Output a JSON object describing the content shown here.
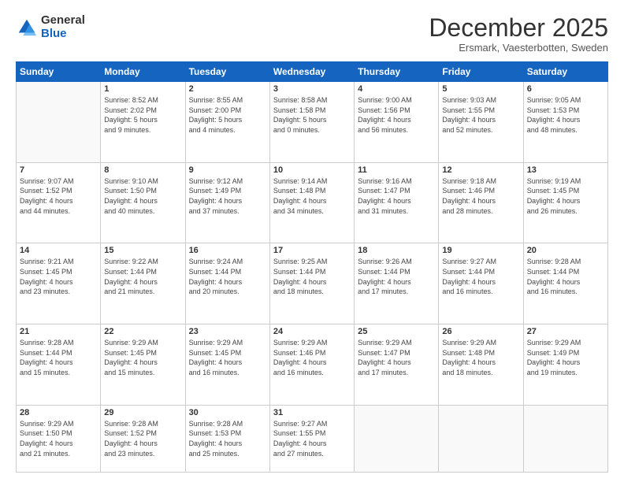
{
  "logo": {
    "general": "General",
    "blue": "Blue"
  },
  "title": "December 2025",
  "location": "Ersmark, Vaesterbotten, Sweden",
  "days_header": [
    "Sunday",
    "Monday",
    "Tuesday",
    "Wednesday",
    "Thursday",
    "Friday",
    "Saturday"
  ],
  "weeks": [
    [
      {
        "day": "",
        "info": ""
      },
      {
        "day": "1",
        "info": "Sunrise: 8:52 AM\nSunset: 2:02 PM\nDaylight: 5 hours\nand 9 minutes."
      },
      {
        "day": "2",
        "info": "Sunrise: 8:55 AM\nSunset: 2:00 PM\nDaylight: 5 hours\nand 4 minutes."
      },
      {
        "day": "3",
        "info": "Sunrise: 8:58 AM\nSunset: 1:58 PM\nDaylight: 5 hours\nand 0 minutes."
      },
      {
        "day": "4",
        "info": "Sunrise: 9:00 AM\nSunset: 1:56 PM\nDaylight: 4 hours\nand 56 minutes."
      },
      {
        "day": "5",
        "info": "Sunrise: 9:03 AM\nSunset: 1:55 PM\nDaylight: 4 hours\nand 52 minutes."
      },
      {
        "day": "6",
        "info": "Sunrise: 9:05 AM\nSunset: 1:53 PM\nDaylight: 4 hours\nand 48 minutes."
      }
    ],
    [
      {
        "day": "7",
        "info": "Sunrise: 9:07 AM\nSunset: 1:52 PM\nDaylight: 4 hours\nand 44 minutes."
      },
      {
        "day": "8",
        "info": "Sunrise: 9:10 AM\nSunset: 1:50 PM\nDaylight: 4 hours\nand 40 minutes."
      },
      {
        "day": "9",
        "info": "Sunrise: 9:12 AM\nSunset: 1:49 PM\nDaylight: 4 hours\nand 37 minutes."
      },
      {
        "day": "10",
        "info": "Sunrise: 9:14 AM\nSunset: 1:48 PM\nDaylight: 4 hours\nand 34 minutes."
      },
      {
        "day": "11",
        "info": "Sunrise: 9:16 AM\nSunset: 1:47 PM\nDaylight: 4 hours\nand 31 minutes."
      },
      {
        "day": "12",
        "info": "Sunrise: 9:18 AM\nSunset: 1:46 PM\nDaylight: 4 hours\nand 28 minutes."
      },
      {
        "day": "13",
        "info": "Sunrise: 9:19 AM\nSunset: 1:45 PM\nDaylight: 4 hours\nand 26 minutes."
      }
    ],
    [
      {
        "day": "14",
        "info": "Sunrise: 9:21 AM\nSunset: 1:45 PM\nDaylight: 4 hours\nand 23 minutes."
      },
      {
        "day": "15",
        "info": "Sunrise: 9:22 AM\nSunset: 1:44 PM\nDaylight: 4 hours\nand 21 minutes."
      },
      {
        "day": "16",
        "info": "Sunrise: 9:24 AM\nSunset: 1:44 PM\nDaylight: 4 hours\nand 20 minutes."
      },
      {
        "day": "17",
        "info": "Sunrise: 9:25 AM\nSunset: 1:44 PM\nDaylight: 4 hours\nand 18 minutes."
      },
      {
        "day": "18",
        "info": "Sunrise: 9:26 AM\nSunset: 1:44 PM\nDaylight: 4 hours\nand 17 minutes."
      },
      {
        "day": "19",
        "info": "Sunrise: 9:27 AM\nSunset: 1:44 PM\nDaylight: 4 hours\nand 16 minutes."
      },
      {
        "day": "20",
        "info": "Sunrise: 9:28 AM\nSunset: 1:44 PM\nDaylight: 4 hours\nand 16 minutes."
      }
    ],
    [
      {
        "day": "21",
        "info": "Sunrise: 9:28 AM\nSunset: 1:44 PM\nDaylight: 4 hours\nand 15 minutes."
      },
      {
        "day": "22",
        "info": "Sunrise: 9:29 AM\nSunset: 1:45 PM\nDaylight: 4 hours\nand 15 minutes."
      },
      {
        "day": "23",
        "info": "Sunrise: 9:29 AM\nSunset: 1:45 PM\nDaylight: 4 hours\nand 16 minutes."
      },
      {
        "day": "24",
        "info": "Sunrise: 9:29 AM\nSunset: 1:46 PM\nDaylight: 4 hours\nand 16 minutes."
      },
      {
        "day": "25",
        "info": "Sunrise: 9:29 AM\nSunset: 1:47 PM\nDaylight: 4 hours\nand 17 minutes."
      },
      {
        "day": "26",
        "info": "Sunrise: 9:29 AM\nSunset: 1:48 PM\nDaylight: 4 hours\nand 18 minutes."
      },
      {
        "day": "27",
        "info": "Sunrise: 9:29 AM\nSunset: 1:49 PM\nDaylight: 4 hours\nand 19 minutes."
      }
    ],
    [
      {
        "day": "28",
        "info": "Sunrise: 9:29 AM\nSunset: 1:50 PM\nDaylight: 4 hours\nand 21 minutes."
      },
      {
        "day": "29",
        "info": "Sunrise: 9:28 AM\nSunset: 1:52 PM\nDaylight: 4 hours\nand 23 minutes."
      },
      {
        "day": "30",
        "info": "Sunrise: 9:28 AM\nSunset: 1:53 PM\nDaylight: 4 hours\nand 25 minutes."
      },
      {
        "day": "31",
        "info": "Sunrise: 9:27 AM\nSunset: 1:55 PM\nDaylight: 4 hours\nand 27 minutes."
      },
      {
        "day": "",
        "info": ""
      },
      {
        "day": "",
        "info": ""
      },
      {
        "day": "",
        "info": ""
      }
    ]
  ]
}
